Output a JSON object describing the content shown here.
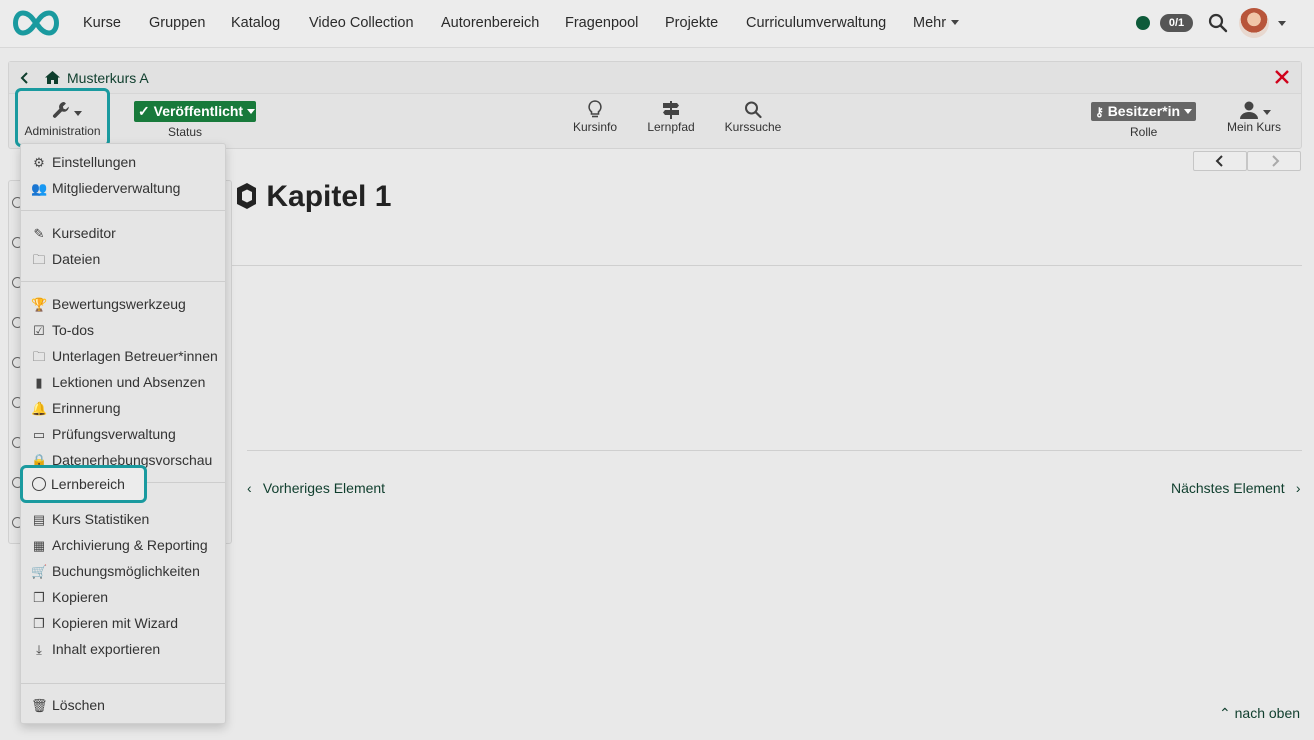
{
  "topnav": {
    "items": [
      {
        "label": "Kurse"
      },
      {
        "label": "Gruppen"
      },
      {
        "label": "Katalog"
      },
      {
        "label": "Video Collection"
      },
      {
        "label": "Autorenbereich"
      },
      {
        "label": "Fragenpool"
      },
      {
        "label": "Projekte"
      },
      {
        "label": "Curriculumverwaltung"
      },
      {
        "label": "Mehr"
      }
    ],
    "counter": "0/1"
  },
  "course": {
    "title": "Musterkurs A",
    "admin_label": "Administration",
    "status_value": "Veröffentlicht",
    "status_label": "Status",
    "kursinfo": "Kursinfo",
    "lernpfad": "Lernpfad",
    "kurssuche": "Kurssuche",
    "role_value": "Besitzer*in",
    "role_label": "Rolle",
    "mein_kurs": "Mein Kurs"
  },
  "content": {
    "title": "Kapitel 1",
    "prev": "Vorheriges Element",
    "next": "Nächstes Element",
    "to_top": "nach oben"
  },
  "menu": {
    "items": [
      {
        "label": "Einstellungen",
        "icon": "gears-icon"
      },
      {
        "label": "Mitgliederverwaltung",
        "icon": "users-icon"
      },
      {
        "label": "Kurseditor",
        "icon": "edit-icon"
      },
      {
        "label": "Dateien",
        "icon": "folder-icon"
      },
      {
        "label": "Bewertungswerkzeug",
        "icon": "trophy-icon"
      },
      {
        "label": "To-dos",
        "icon": "checkbox-icon"
      },
      {
        "label": "Unterlagen Betreuer*innen",
        "icon": "folder-icon"
      },
      {
        "label": "Lektionen und Absenzen",
        "icon": "book-icon"
      },
      {
        "label": "Erinnerung",
        "icon": "bell-icon"
      },
      {
        "label": "Prüfungsverwaltung",
        "icon": "exam-icon"
      },
      {
        "label": "Datenerhebungsvorschau",
        "icon": "lock-icon"
      },
      {
        "label": "Lernbereich",
        "icon": "circle-icon"
      },
      {
        "label": "Kurs Statistiken",
        "icon": "chart-icon"
      },
      {
        "label": "Archivierung & Reporting",
        "icon": "archive-icon"
      },
      {
        "label": "Buchungsmöglichkeiten",
        "icon": "cart-icon"
      },
      {
        "label": "Kopieren",
        "icon": "copy-icon"
      },
      {
        "label": "Kopieren mit Wizard",
        "icon": "copy-icon"
      },
      {
        "label": "Inhalt exportieren",
        "icon": "download-icon"
      },
      {
        "label": "Löschen",
        "icon": "trash-icon"
      }
    ]
  },
  "colors": {
    "brand": "#1a9a9f",
    "published": "#187a3b",
    "link": "#0f3e2d",
    "close": "#d0021b"
  }
}
